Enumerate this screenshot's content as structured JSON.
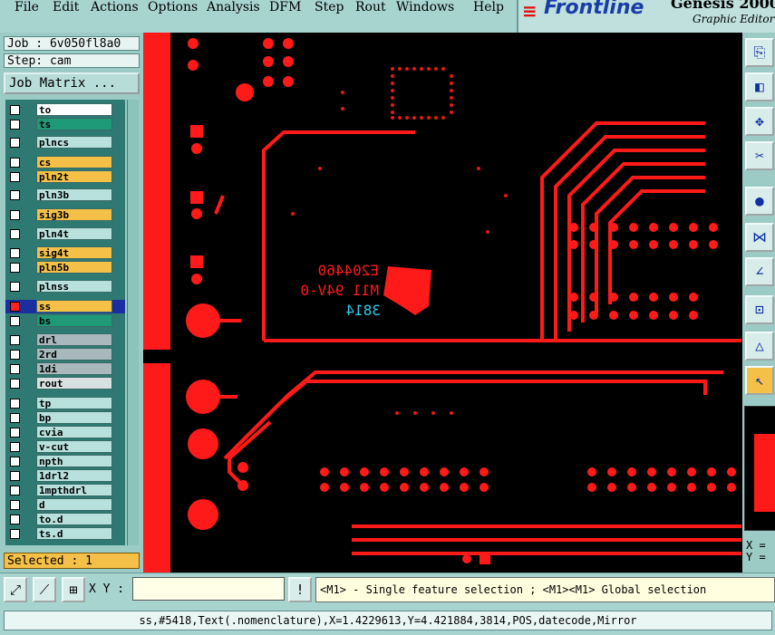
{
  "menu": [
    "File",
    "Edit",
    "Actions",
    "Options",
    "Analysis",
    "DFM",
    "Step",
    "Rout",
    "Windows",
    "Help"
  ],
  "brand": {
    "logo": "Frontline",
    "title": "Genesis 2000",
    "subtitle": "Graphic Editor"
  },
  "job": {
    "label": "Job : 6v050fl8a0",
    "step": "Step: cam",
    "matrix_button": "Job Matrix ..."
  },
  "layers": [
    {
      "name": "to",
      "color": "#ffffff"
    },
    {
      "name": "ts",
      "color": "#1f9a78"
    },
    {
      "name": "plncs",
      "color": "#b8e0dc"
    },
    {
      "name": "cs",
      "color": "#f4c048"
    },
    {
      "name": "pln2t",
      "color": "#f4c048"
    },
    {
      "name": "pln3b",
      "color": "#b8e0dc"
    },
    {
      "name": "sig3b",
      "color": "#f4c048"
    },
    {
      "name": "pln4t",
      "color": "#b8e0dc"
    },
    {
      "name": "sig4t",
      "color": "#f4c048"
    },
    {
      "name": "pln5b",
      "color": "#f4c048"
    },
    {
      "name": "plnss",
      "color": "#b8e0dc"
    },
    {
      "name": "ss",
      "color": "#f4c048",
      "selected": true
    },
    {
      "name": "bs",
      "color": "#1f9a78"
    },
    {
      "name": "drl",
      "color": "#a8b8bc"
    },
    {
      "name": "2rd",
      "color": "#a8b8bc"
    },
    {
      "name": "1di",
      "color": "#a8b8bc"
    },
    {
      "name": "rout",
      "color": "#d8e0e0"
    },
    {
      "name": "tp",
      "color": "#b8e0dc"
    },
    {
      "name": "bp",
      "color": "#b8e0dc"
    },
    {
      "name": "cvia",
      "color": "#b8e0dc"
    },
    {
      "name": "v-cut",
      "color": "#b8e0dc"
    },
    {
      "name": "npth",
      "color": "#b8e0dc"
    },
    {
      "name": "1drl2",
      "color": "#b8e0dc"
    },
    {
      "name": "1mpthdrl",
      "color": "#b8e0dc"
    },
    {
      "name": "d",
      "color": "#b8e0dc"
    },
    {
      "name": "to.d",
      "color": "#b8e0dc"
    },
    {
      "name": "ts.d",
      "color": "#b8e0dc"
    }
  ],
  "selected_count": "Selected : 1",
  "nomenclature": {
    "line1": "E204460",
    "line2": "M11 94V-0",
    "datecode": "3814"
  },
  "xy_label": "X Y :",
  "xy_input_value": "",
  "xy_readout": {
    "x": "X =",
    "y": "Y ="
  },
  "hint": "<M1> - Single feature selection ; <M1><M1> Global selection",
  "status": "ss,#5418,Text(.nomenclature),X=1.4229613,Y=4.421884,3814,POS,datecode,Mirror",
  "icons": [
    "zoom-fit-icon",
    "zoom-area-icon",
    "grid-icon",
    "warning-icon"
  ],
  "colors": {
    "trace": "#ff1a1a",
    "background": "#000000",
    "panel": "#9ccbc5",
    "highlight": "#f4c048"
  }
}
